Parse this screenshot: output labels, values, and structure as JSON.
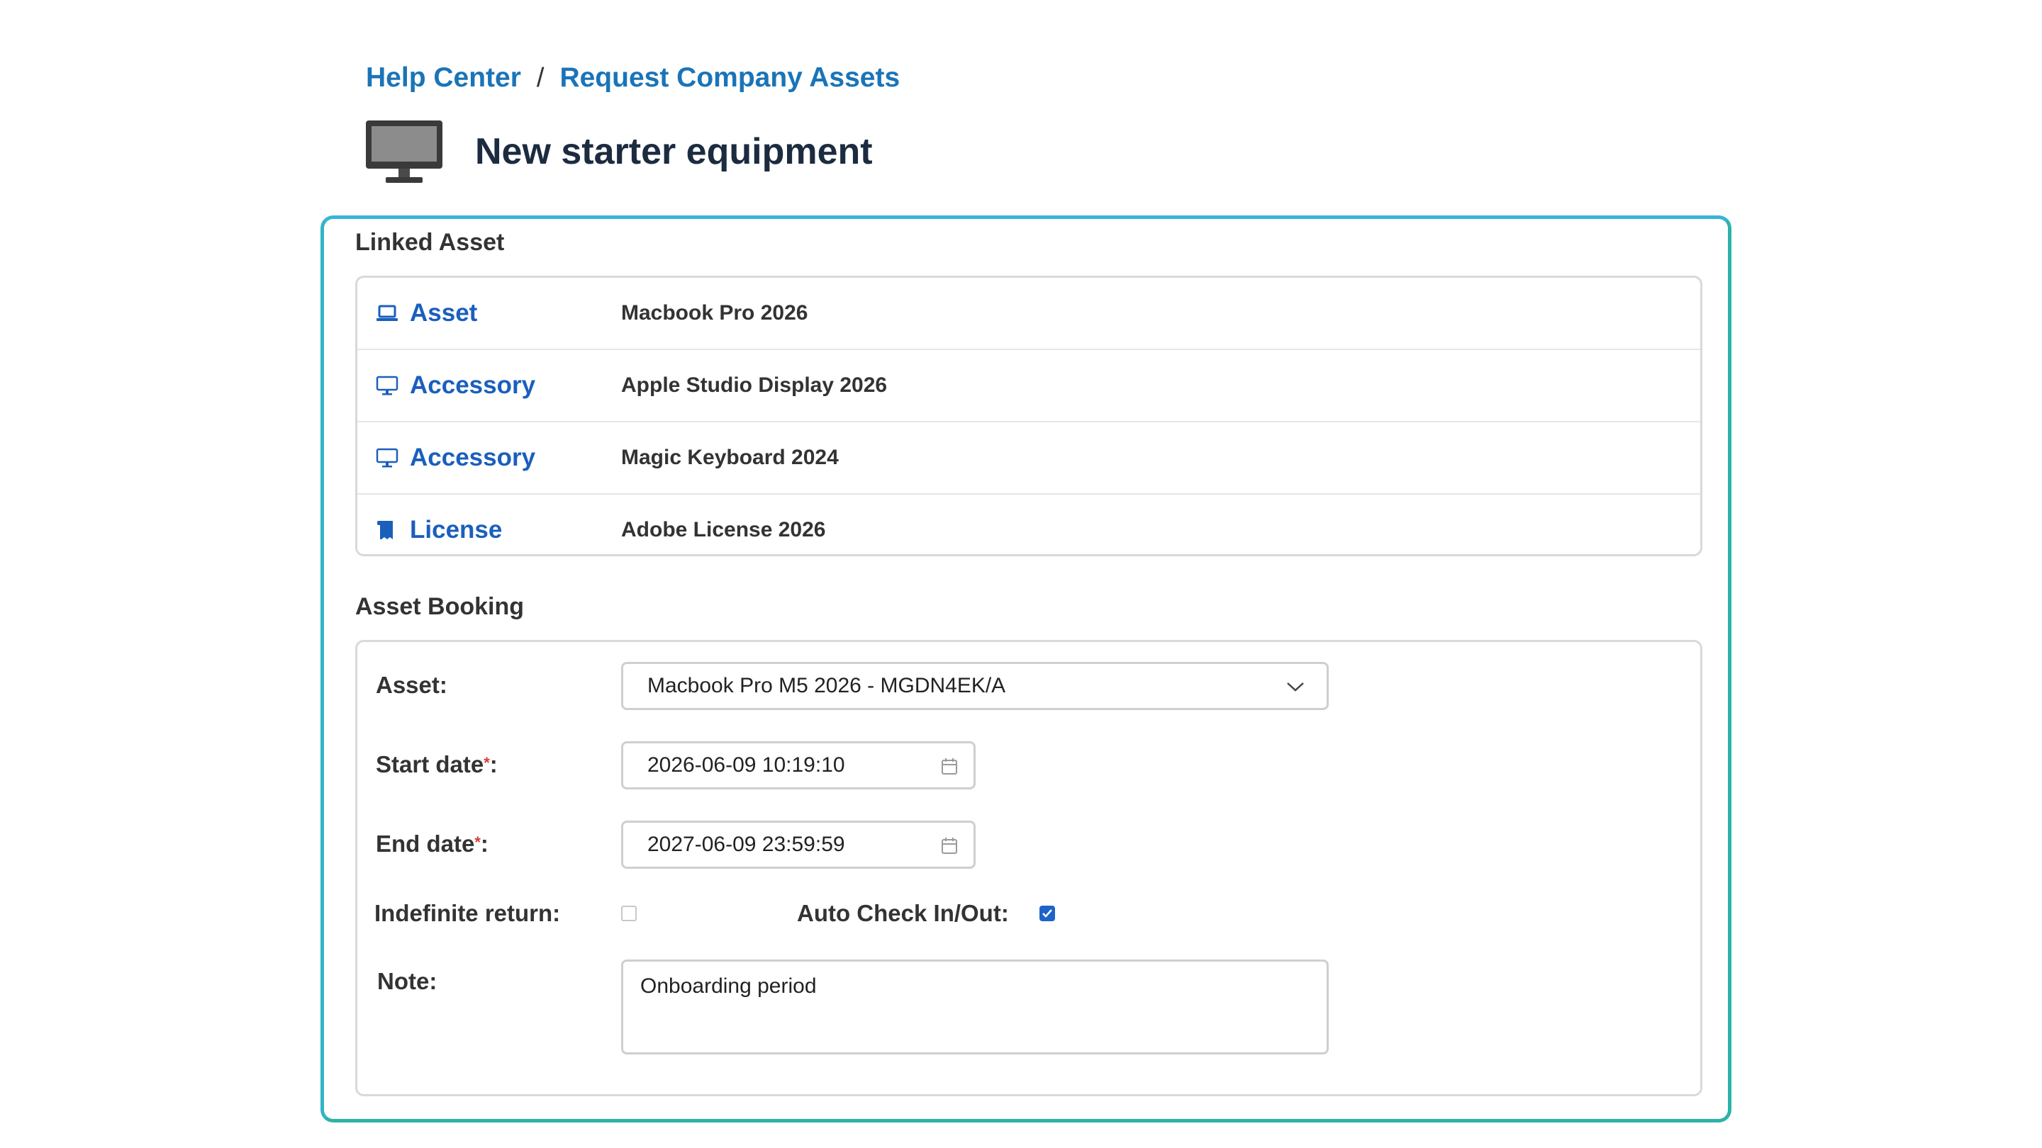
{
  "breadcrumb": {
    "items": [
      "Help Center",
      "Request Company Assets"
    ],
    "separator": "/"
  },
  "page": {
    "title": "New starter equipment",
    "icon": "monitor-icon"
  },
  "linked_asset": {
    "heading": "Linked Asset",
    "rows": [
      {
        "type": "Asset",
        "icon": "laptop-icon",
        "name": "Macbook Pro 2026"
      },
      {
        "type": "Accessory",
        "icon": "monitor-icon",
        "name": "Apple Studio Display 2026"
      },
      {
        "type": "Accessory",
        "icon": "monitor-icon",
        "name": "Magic Keyboard 2024"
      },
      {
        "type": "License",
        "icon": "license-icon",
        "name": "Adobe License 2026"
      }
    ]
  },
  "asset_booking": {
    "heading": "Asset Booking",
    "asset_label": "Asset:",
    "asset_value": "Macbook Pro M5 2026 - MGDN4EK/A",
    "start_label": "Start date",
    "start_value": "2026-06-09 10:19:10",
    "end_label": "End date",
    "end_value": "2027-06-09 23:59:59",
    "required_mark": "*",
    "colon": ":",
    "indefinite_label": "Indefinite return:",
    "indefinite_checked": false,
    "auto_check_label": "Auto Check In/Out:",
    "auto_check_checked": true,
    "note_label": "Note:",
    "note_value": "Onboarding period"
  },
  "colors": {
    "link": "#1a74b8",
    "card_border": "#2db3a7",
    "checkbox_checked": "#1e63c9"
  }
}
